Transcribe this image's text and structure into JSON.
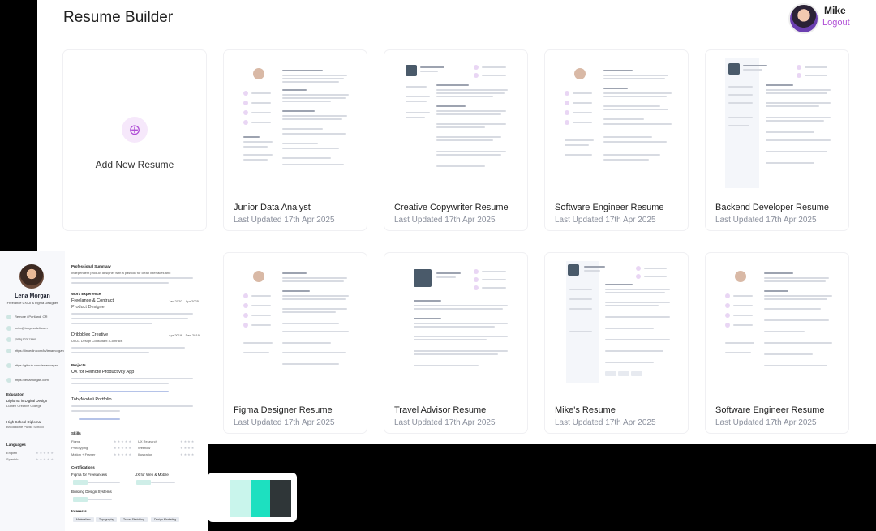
{
  "header": {
    "title": "Resume Builder"
  },
  "user": {
    "name": "Mike",
    "logout_label": "Logout"
  },
  "add_card": {
    "label": "Add New Resume",
    "icon": "plus-circle-icon"
  },
  "resumes": [
    {
      "title": "Junior Data Analyst",
      "updated": "Last Updated 17th Apr 2025"
    },
    {
      "title": "Creative Copywriter Resume",
      "updated": "Last Updated 17th Apr 2025"
    },
    {
      "title": "Software Engineer Resume",
      "updated": "Last Updated 17th Apr 2025"
    },
    {
      "title": "Backend Developer Resume",
      "updated": "Last Updated 17th Apr 2025"
    },
    {
      "title": "Figma Designer Resume",
      "updated": "Last Updated 17th Apr 2025"
    },
    {
      "title": "Travel Advisor Resume",
      "updated": "Last Updated 17th Apr 2025"
    },
    {
      "title": "Mike's Resume",
      "updated": "Last Updated 17th Apr 2025"
    },
    {
      "title": "Software Engineer Resume",
      "updated": "Last Updated 17th Apr 2025"
    }
  ],
  "preview": {
    "name": "Lena Morgan",
    "role": "Freelance UX/UI & Figma Designer",
    "contacts": [
      "Remote / Portland, OR",
      "hello@tobymodeli.com",
      "(555)123-7890",
      "https://linkedin.com/in/lenamorgan",
      "https://github.com/lenamorgan",
      "https://lenamorgan.com"
    ],
    "education_h": "Education",
    "education": [
      "Diploma in Digital Design",
      "Lumen Creative College",
      "High School Diploma",
      "Brookstone Public School"
    ],
    "languages_h": "Languages",
    "languages": [
      "English",
      "Spanish"
    ],
    "summary_h": "Professional Summary",
    "summary": "Independent product designer with a passion for clean interfaces and",
    "work_h": "Work Experience",
    "job1_title": "Freelance & Contract",
    "job1_role": "Product Designer",
    "job1_dates": "Jan 2020 – Apr 2025",
    "job2_title": "Dribbblex Creative",
    "job2_role": "UI/UX Design Consultant (Contract)",
    "job2_dates": "Apr 2019 – Dec 2019",
    "projects_h": "Projects",
    "proj1": "UX for Remote Productivity App",
    "proj2": "TobyModeli Portfolio",
    "skills_h": "Skills",
    "skills": [
      "Figma",
      "Prototyping",
      "Motion + Framer",
      "UX Research",
      "Webflow",
      "Illustration"
    ],
    "certs_h": "Certifications",
    "cert1": "Figma for Freelancers",
    "cert2": "UX for Web & Mobile",
    "cert3": "Building Design Systems",
    "interests_h": "Interests",
    "interests": [
      "Minimalism",
      "Typography",
      "Travel Sketching",
      "Design Marketing"
    ]
  },
  "palette": [
    "#ffffff",
    "#c9f5ec",
    "#1de0c0",
    "#2f3638"
  ]
}
